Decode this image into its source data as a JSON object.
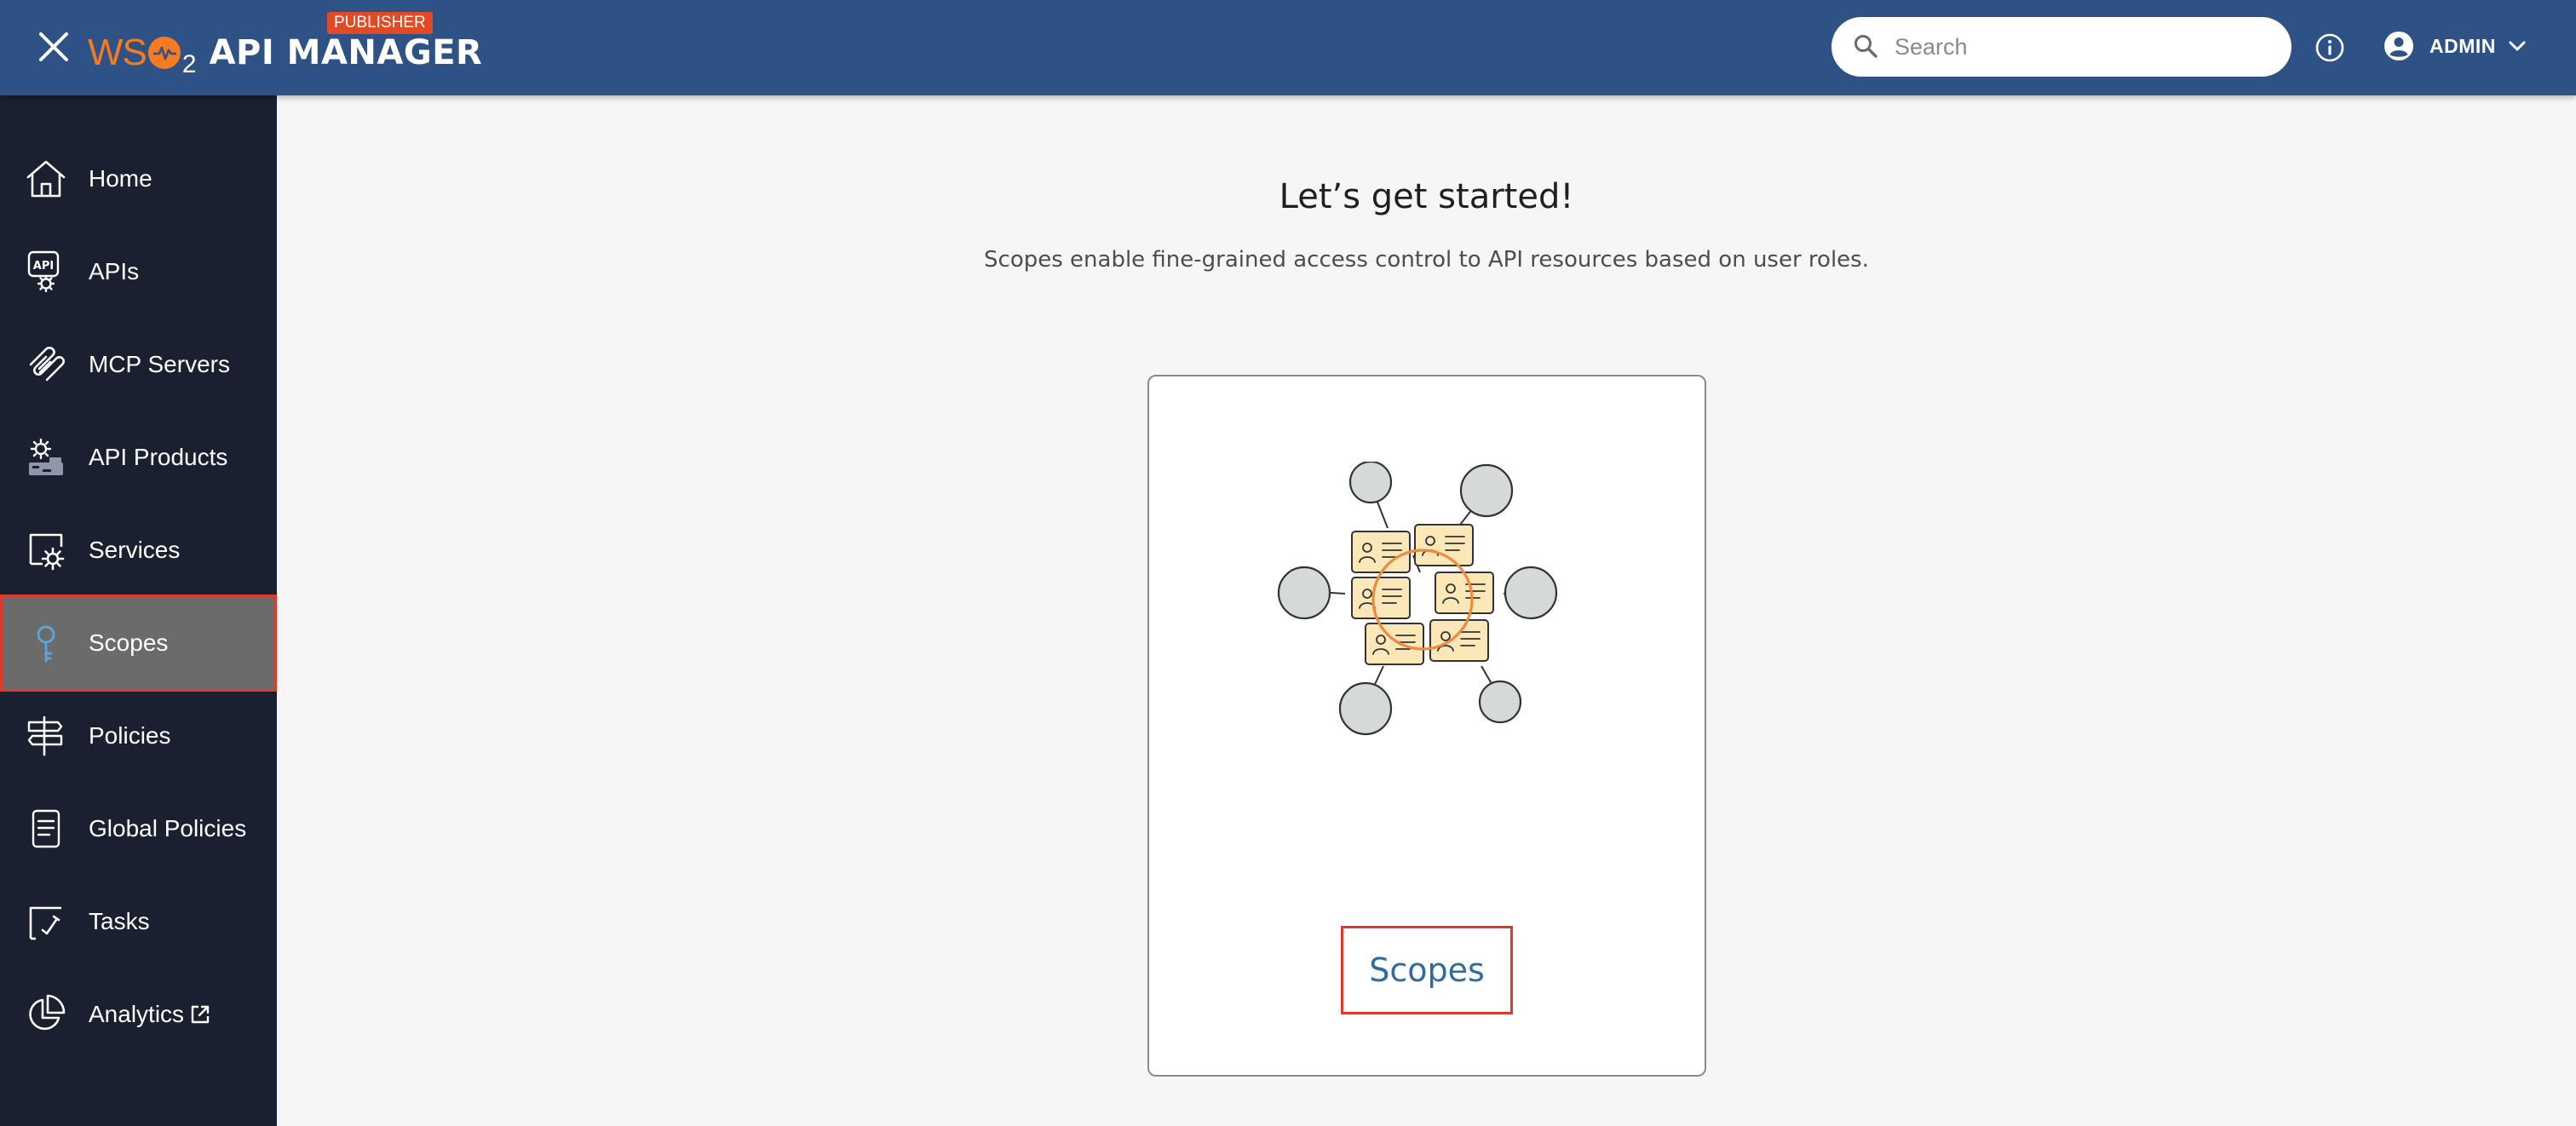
{
  "header": {
    "brand": {
      "logo_w": "WS",
      "logo_2": "2",
      "product": "API MANAGER",
      "badge": "PUBLISHER"
    },
    "search_placeholder": "Search",
    "user": "ADMIN",
    "icons": [
      "close-icon",
      "search-icon",
      "info-icon",
      "account-circle-icon",
      "chevron-down-icon"
    ],
    "colors": {
      "bar": "#2f5286",
      "brand_orange": "#f47b20",
      "badge": "#e04a27"
    }
  },
  "sidebar": {
    "colors": {
      "background": "#1b2030",
      "active": "#6b6b6b",
      "highlight_border": "#e0392b"
    },
    "items": [
      {
        "label": "Home",
        "icon": "home-icon"
      },
      {
        "label": "APIs",
        "icon": "api-gear-icon"
      },
      {
        "label": "MCP Servers",
        "icon": "mcp-servers-icon"
      },
      {
        "label": "API Products",
        "icon": "api-products-icon"
      },
      {
        "label": "Services",
        "icon": "services-gear-icon"
      },
      {
        "label": "Scopes",
        "icon": "key-icon",
        "active": true
      },
      {
        "label": "Policies",
        "icon": "signpost-icon"
      },
      {
        "label": "Global Policies",
        "icon": "document-icon"
      },
      {
        "label": "Tasks",
        "icon": "tasks-icon"
      },
      {
        "label": "Analytics",
        "icon": "pie-chart-icon",
        "external": true
      }
    ]
  },
  "main": {
    "title": "Let’s get started!",
    "subtitle": "Scopes enable fine-grained access control to API resources based on user roles.",
    "card": {
      "link_label": "Scopes",
      "link_color": "#2e6b9e",
      "illustration": "scopes-network-illustration"
    }
  }
}
